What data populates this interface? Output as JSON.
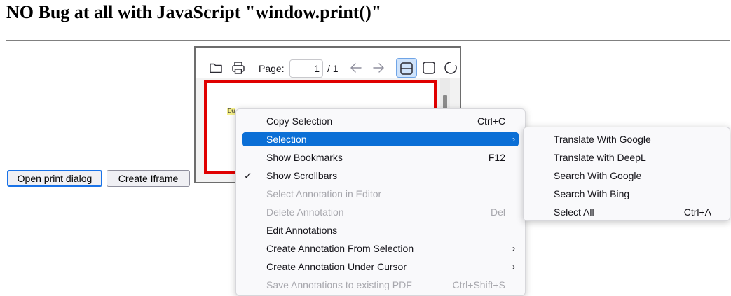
{
  "page": {
    "heading": "NO Bug at all with JavaScript \"window.print()\"",
    "buttons": {
      "open_print": "Open print dialog",
      "create_iframe": "Create Iframe"
    }
  },
  "viewer": {
    "toolbar": {
      "open_icon": "folder-icon",
      "print_icon": "printer-icon",
      "page_label": "Page:",
      "page_value": "1",
      "page_count": "/ 1",
      "prev_icon": "arrow-left-icon",
      "next_icon": "arrow-right-icon",
      "scroll_mode_icon": "vertical-scroll-icon",
      "page_mode_icon": "single-page-icon",
      "rotate_icon": "rotate-icon"
    },
    "document": {
      "highlighted_text": "Du",
      "page_border_color": "#e00000"
    }
  },
  "context_menu": {
    "items": [
      {
        "label": "Copy Selection",
        "shortcut": "Ctrl+C",
        "disabled": false
      },
      {
        "label": "Selection",
        "shortcut": "",
        "submenu": true,
        "highlighted": true
      },
      {
        "label": "Show Bookmarks",
        "shortcut": "F12",
        "disabled": false
      },
      {
        "label": "Show Scrollbars",
        "shortcut": "",
        "checked": true
      },
      {
        "label": "Select Annotation in Editor",
        "shortcut": "",
        "disabled": true
      },
      {
        "label": "Delete Annotation",
        "shortcut": "Del",
        "disabled": true
      },
      {
        "label": "Edit Annotations",
        "shortcut": "",
        "disabled": false
      },
      {
        "label": "Create Annotation From Selection",
        "shortcut": "",
        "submenu": true
      },
      {
        "label": "Create Annotation Under Cursor",
        "shortcut": "",
        "submenu": true
      },
      {
        "label": "Save Annotations to existing PDF",
        "shortcut": "Ctrl+Shift+S",
        "disabled": true
      }
    ],
    "check_glyph": "✓",
    "arrow_glyph": "›"
  },
  "submenu": {
    "items": [
      {
        "label": "Translate With Google",
        "shortcut": ""
      },
      {
        "label": "Translate with DeepL",
        "shortcut": ""
      },
      {
        "label": "Search With Google",
        "shortcut": ""
      },
      {
        "label": "Search With Bing",
        "shortcut": ""
      },
      {
        "label": "Select All",
        "shortcut": "Ctrl+A"
      }
    ]
  },
  "colors": {
    "menu_highlight": "#0b6fd6",
    "menu_background": "#f9f9fb",
    "disabled_text": "#a7a7ad"
  }
}
